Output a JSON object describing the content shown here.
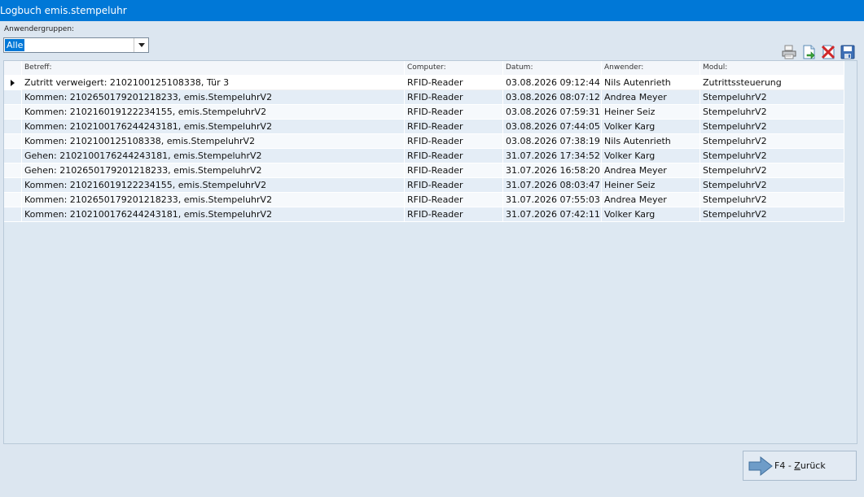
{
  "window": {
    "title": "Logbuch emis.stempeluhr"
  },
  "filter": {
    "label": "Anwendergruppen:",
    "selected": "Alle"
  },
  "toolbar": {
    "icons": [
      "printer-icon",
      "export-icon",
      "delete-icon",
      "save-icon"
    ]
  },
  "table": {
    "columns": [
      "Betreff:",
      "Computer:",
      "Datum:",
      "Anwender:",
      "Modul:"
    ],
    "rows": [
      [
        "Zutritt verweigert: 2102100125108338, Tür 3",
        "RFID-Reader",
        "03.08.2026 09:12:44",
        "Nils Autenrieth",
        "Zutrittssteuerung"
      ],
      [
        "Kommen: 2102650179201218233, emis.StempeluhrV2",
        "RFID-Reader",
        "03.08.2026 08:07:12",
        "Andrea Meyer",
        "StempeluhrV2"
      ],
      [
        "Kommen: 210216019122234155, emis.StempeluhrV2",
        "RFID-Reader",
        "03.08.2026 07:59:31",
        "Heiner Seiz",
        "StempeluhrV2"
      ],
      [
        "Kommen: 2102100176244243181, emis.StempeluhrV2",
        "RFID-Reader",
        "03.08.2026 07:44:05",
        "Volker Karg",
        "StempeluhrV2"
      ],
      [
        "Kommen: 2102100125108338, emis.StempeluhrV2",
        "RFID-Reader",
        "03.08.2026 07:38:19",
        "Nils Autenrieth",
        "StempeluhrV2"
      ],
      [
        "Gehen: 2102100176244243181, emis.StempeluhrV2",
        "RFID-Reader",
        "31.07.2026 17:34:52",
        "Volker Karg",
        "StempeluhrV2"
      ],
      [
        "Gehen: 2102650179201218233, emis.StempeluhrV2",
        "RFID-Reader",
        "31.07.2026 16:58:20",
        "Andrea Meyer",
        "StempeluhrV2"
      ],
      [
        "Kommen: 210216019122234155, emis.StempeluhrV2",
        "RFID-Reader",
        "31.07.2026 08:03:47",
        "Heiner Seiz",
        "StempeluhrV2"
      ],
      [
        "Kommen: 2102650179201218233, emis.StempeluhrV2",
        "RFID-Reader",
        "31.07.2026 07:55:03",
        "Andrea Meyer",
        "StempeluhrV2"
      ],
      [
        "Kommen: 2102100176244243181, emis.StempeluhrV2",
        "RFID-Reader",
        "31.07.2026 07:42:11",
        "Volker Karg",
        "StempeluhrV2"
      ]
    ]
  },
  "footer": {
    "back_label_prefix": "F4 - ",
    "back_label_key": "Z",
    "back_label_rest": "urück"
  }
}
